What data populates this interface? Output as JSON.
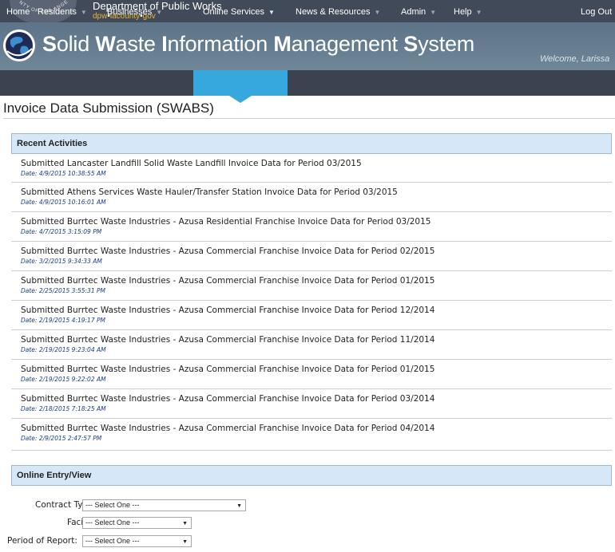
{
  "header": {
    "seal_text": "COUNTY OF LOS ANGELES",
    "department": "Department of Public Works",
    "website_prefix": "dpw",
    "website_mid": "lacounty",
    "website_suffix": "gov",
    "system_title_parts": [
      "S",
      "olid ",
      "W",
      "aste ",
      "I",
      "nformation ",
      "M",
      "anagement ",
      "S",
      "ystem"
    ],
    "welcome": "Welcome, Larissa"
  },
  "nav": {
    "items": [
      {
        "label": "Home",
        "has_menu": false
      },
      {
        "label": "Residents",
        "has_menu": true
      },
      {
        "label": "Businesses",
        "has_menu": true
      },
      {
        "label": "Online Services",
        "has_menu": true,
        "active": true
      },
      {
        "label": "News & Resources",
        "has_menu": true
      },
      {
        "label": "Admin",
        "has_menu": true
      },
      {
        "label": "Help",
        "has_menu": true
      }
    ],
    "logout": "Log Out",
    "caret": "▼"
  },
  "page": {
    "title": "Invoice Data Submission (SWABS)"
  },
  "recent": {
    "header": "Recent Activities",
    "items": [
      {
        "text": "Submitted Lancaster Landfill Solid Waste Landfill Invoice Data for Period 03/2015",
        "date": "Date: 4/9/2015 10:38:55 AM"
      },
      {
        "text": "Submitted Athens Services Waste Hauler/Transfer Station Invoice Data for Period 03/2015",
        "date": "Date: 4/9/2015 10:16:01 AM"
      },
      {
        "text": "Submitted Burrtec Waste Industries - Azusa Residential Franchise Invoice Data for Period 03/2015",
        "date": "Date: 4/7/2015 3:15:09 PM"
      },
      {
        "text": "Submitted Burrtec Waste Industries - Azusa Commercial Franchise Invoice Data for Period 02/2015",
        "date": "Date: 3/2/2015 9:34:33 AM"
      },
      {
        "text": "Submitted Burrtec Waste Industries - Azusa Commercial Franchise Invoice Data for Period 01/2015",
        "date": "Date: 2/25/2015 3:55:31 PM"
      },
      {
        "text": "Submitted Burrtec Waste Industries - Azusa Commercial Franchise Invoice Data for Period 12/2014",
        "date": "Date: 2/19/2015 4:19:17 PM"
      },
      {
        "text": "Submitted Burrtec Waste Industries - Azusa Commercial Franchise Invoice Data for Period 11/2014",
        "date": "Date: 2/19/2015 9:23:04 AM"
      },
      {
        "text": "Submitted Burrtec Waste Industries - Azusa Commercial Franchise Invoice Data for Period 01/2015",
        "date": "Date: 2/19/2015 9:22:02 AM"
      },
      {
        "text": "Submitted Burrtec Waste Industries - Azusa Commercial Franchise Invoice Data for Period 03/2014",
        "date": "Date: 2/18/2015 7:18:25 AM"
      },
      {
        "text": "Submitted Burrtec Waste Industries - Azusa Commercial Franchise Invoice Data for Period 04/2014",
        "date": "Date: 2/9/2015 2:47:57 PM"
      }
    ]
  },
  "entry": {
    "header": "Online Entry/View",
    "fields": [
      {
        "label": "Contract Type:",
        "value": "--- Select One ---"
      },
      {
        "label": "Facility:",
        "value": "--- Select One ---"
      },
      {
        "label": "Period of Report:",
        "value": "--- Select One ---"
      }
    ]
  },
  "colors": {
    "topbar": "#404a59",
    "banner": "#6a8196",
    "navbar": "#3a434f",
    "active": "#36a8de",
    "section_header_bg": "#d6e8f8",
    "date_text": "#1a3d8a",
    "gold": "#e9b430"
  },
  "icons": {
    "logo": "globe-logo-icon",
    "seal": "county-seal-icon",
    "dropdown": "dropdown-arrow-icon"
  }
}
